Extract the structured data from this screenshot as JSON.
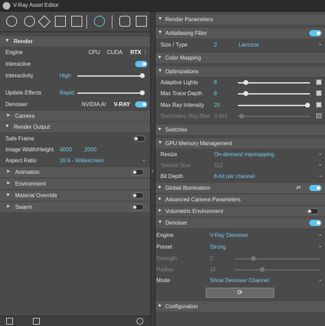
{
  "window": {
    "title": "V-Ray Asset Editor"
  },
  "toolbar": {
    "icons": [
      "light-icon",
      "geometry-icon",
      "materials-icon",
      "textures-icon",
      "render-elements-icon",
      "settings-icon",
      "render-interactive-icon",
      "frame-buffer-icon"
    ]
  },
  "left": {
    "render": {
      "header": "Render",
      "engine_label": "Engine",
      "engine_options": [
        "CPU",
        "CUDA",
        "RTX"
      ],
      "engine_selected": "RTX",
      "interactive_label": "Interactive",
      "interactive_on": true,
      "interactivity_label": "Interactivity",
      "interactivity_value": "High",
      "update_effects_label": "Update Effects",
      "update_effects_value": "Rapid",
      "denoiser_label": "Denoiser",
      "denoiser_options": [
        "NVIDIA AI",
        "V-RAY"
      ],
      "denoiser_on": true
    },
    "camera": {
      "header": "Camera"
    },
    "render_output": {
      "header": "Render Output",
      "safe_frame_label": "Safe Frame",
      "safe_frame_on": false,
      "size_label": "Image Width/Height",
      "width": "4000",
      "height": "2000",
      "aspect_label": "Aspect Ratio",
      "aspect_value": "16:9 - Widescreen"
    },
    "animation": {
      "header": "Animation",
      "on": false
    },
    "environment": {
      "header": "Environment"
    },
    "material_override": {
      "header": "Material Override",
      "on": false
    },
    "swarm": {
      "header": "Swarm",
      "on": false
    }
  },
  "right": {
    "render_parameters": {
      "header": "Render Parameters"
    },
    "antialiasing": {
      "header": "Antialiasing Filter",
      "on": true,
      "size_type_label": "Size / Type",
      "size_value": "2",
      "type_value": "Lanczos"
    },
    "color_mapping": {
      "header": "Color Mapping"
    },
    "optimizations": {
      "header": "Optimizations",
      "adaptive_lights_label": "Adaptive Lights",
      "adaptive_lights_value": "8",
      "max_trace_depth_label": "Max Trace Depth",
      "max_trace_depth_value": "8",
      "max_ray_intensity_label": "Max Ray Intensity",
      "max_ray_intensity_value": "20",
      "secondary_ray_bias_label": "Secondary Ray Bias",
      "secondary_ray_bias_value": "0.001"
    },
    "switches": {
      "header": "Switches"
    },
    "gpu_memory": {
      "header": "GPU Memory Management",
      "resize_label": "Resize",
      "resize_value": "On-demand mipmapping",
      "texture_size_label": "Texture Size",
      "texture_size_value": "512",
      "bit_depth_label": "Bit Depth",
      "bit_depth_value": "8-bit per channel"
    },
    "global_illumination": {
      "header": "Global Illumination",
      "on": true
    },
    "advanced_camera": {
      "header": "Advanced Camera Parameters"
    },
    "volumetric": {
      "header": "Volumetric Environment",
      "on": false
    },
    "denoiser": {
      "header": "Denoiser",
      "on": true,
      "engine_label": "Engine",
      "engine_value": "V-Ray Denoiser",
      "preset_label": "Preset",
      "preset_value": "Strong",
      "strength_label": "Strength",
      "strength_value": "2",
      "radius_label": "Radius",
      "radius_value": "15",
      "mode_label": "Mode",
      "mode_value": "Show Denoiser Channel",
      "refresh_icon": "refresh-icon"
    },
    "configuration": {
      "header": "Configuration"
    }
  },
  "bottom": {
    "icons": [
      "open-file-icon",
      "save-file-icon",
      "revert-icon"
    ]
  },
  "colors": {
    "accent": "#5fc3ee",
    "value_text": "#77c8ee",
    "panel_bg": "#4a4a4a",
    "section_bg": "#575757"
  }
}
